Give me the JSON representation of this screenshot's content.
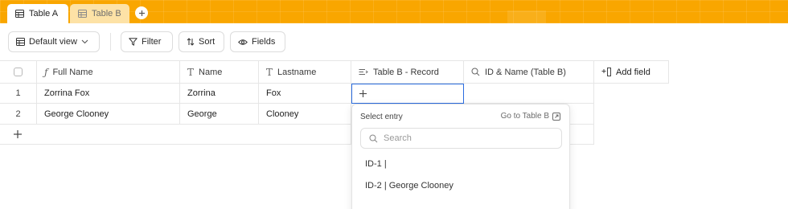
{
  "tabs": [
    {
      "label": "Table A",
      "active": true
    },
    {
      "label": "Table B",
      "active": false
    }
  ],
  "toolbar": {
    "view_label": "Default view",
    "filter_label": "Filter",
    "sort_label": "Sort",
    "fields_label": "Fields"
  },
  "grid": {
    "columns": [
      "Full Name",
      "Name",
      "Lastname",
      "Table B - Record",
      "ID & Name (Table B)",
      "Add field"
    ],
    "rows": [
      {
        "num": "1",
        "full_name": "Zorrina Fox",
        "name": "Zorrina",
        "lastname": "Fox"
      },
      {
        "num": "2",
        "full_name": "George Clooney",
        "name": "George",
        "lastname": "Clooney"
      }
    ]
  },
  "dropdown": {
    "title": "Select entry",
    "goto_label": "Go to Table B",
    "search_placeholder": "Search",
    "items": [
      "ID-1 |",
      "ID-2 | George Clooney"
    ]
  },
  "colors": {
    "accent": "#f9a600",
    "selection": "#2b6de0"
  }
}
